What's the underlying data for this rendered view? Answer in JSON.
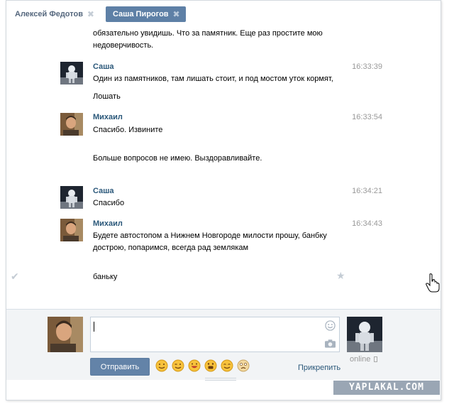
{
  "tabs": [
    {
      "label": "Алексей Федотов",
      "active": false
    },
    {
      "label": "Саша Пирогов",
      "active": true
    }
  ],
  "close_glyph": "✖",
  "messages": [
    {
      "lines": [
        "обязательно увидишь. Что за памятник. Еще раз простите мою",
        "недоверчивость."
      ]
    },
    {
      "author": "Саша",
      "time": "16:33:39",
      "lines": [
        "Один из памятников, там лишать стоит, и под мостом уток кормят,",
        "Лошать"
      ]
    },
    {
      "author": "Михаил",
      "time": "16:33:54",
      "lines": [
        "Спасибо. Извините",
        "Больше вопросов не имею. Выздоравливайте."
      ]
    },
    {
      "author": "Саша",
      "time": "16:34:21",
      "lines": [
        "Спасибо"
      ]
    },
    {
      "author": "Михаил",
      "time": "16:34:43",
      "lines": [
        "Будете автостопом а Нижнем Новгороде милости прошу, банбку",
        "дострою, попаримся, всегда рад землякам",
        "баньку"
      ]
    }
  ],
  "composer": {
    "send_label": "Отправить",
    "attach_label": "Прикрепить",
    "status": "online"
  },
  "watermark": "YAPLAKAL.COM",
  "colors": {
    "accent": "#5e80a6",
    "link": "#2b587a",
    "muted": "#999999"
  }
}
